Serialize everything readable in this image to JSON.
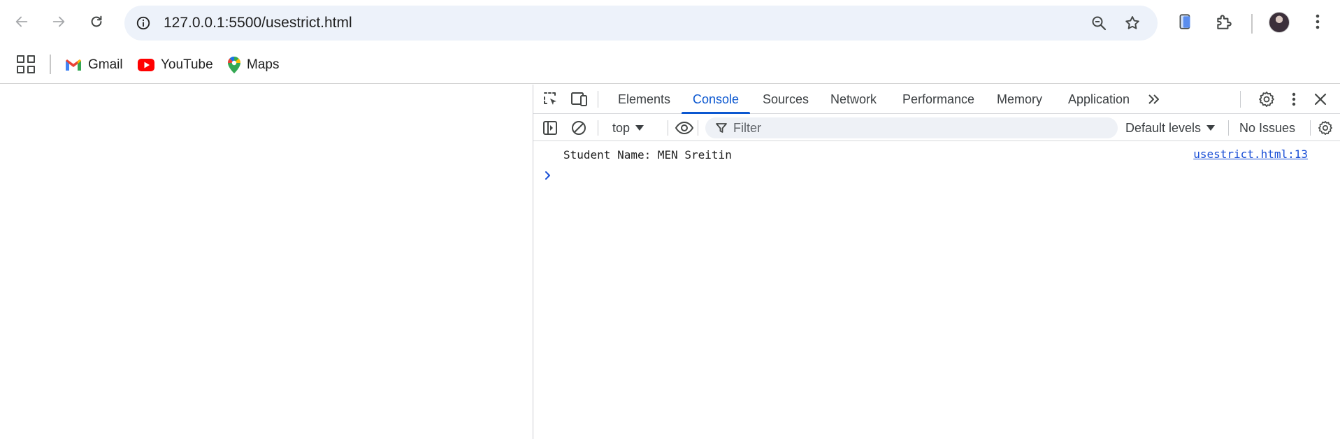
{
  "browser": {
    "url": "127.0.0.1:5500/usestrict.html"
  },
  "bookmarks": [
    {
      "label": "Gmail"
    },
    {
      "label": "YouTube"
    },
    {
      "label": "Maps"
    }
  ],
  "devtools": {
    "tabs": [
      {
        "label": "Elements"
      },
      {
        "label": "Console"
      },
      {
        "label": "Sources"
      },
      {
        "label": "Network"
      },
      {
        "label": "Performance"
      },
      {
        "label": "Memory"
      },
      {
        "label": "Application"
      }
    ],
    "active_tab": "Console",
    "toolbar": {
      "context": "top",
      "filter_placeholder": "Filter",
      "levels": "Default levels",
      "issues": "No Issues"
    },
    "console": {
      "messages": [
        {
          "text": "Student Name: MEN Sreitin",
          "source": "usestrict.html:13"
        }
      ]
    }
  },
  "colors": {
    "accent": "#0b57d0",
    "omnibox_bg": "#edf2fa",
    "link": "#1a4fd6"
  }
}
